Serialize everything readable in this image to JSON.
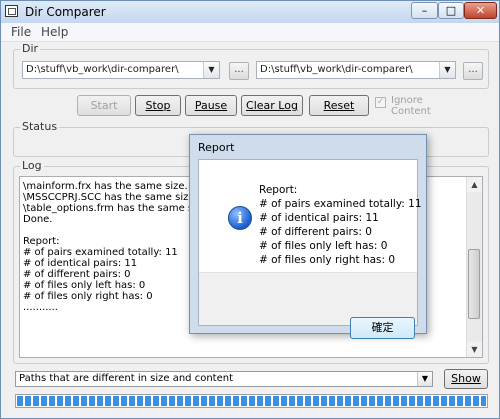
{
  "window": {
    "title": "Dir Comparer",
    "minimize": "–",
    "maximize": "□",
    "close": "✕"
  },
  "menu": {
    "items": [
      {
        "label": "File"
      },
      {
        "label": "Help"
      }
    ]
  },
  "dir_group": {
    "label": "Dir",
    "left_path": "D:\\stuff\\vb_work\\dir-comparer\\",
    "right_path": "D:\\stuff\\vb_work\\dir-comparer\\",
    "browse_label": "..."
  },
  "buttons": {
    "start": "Start",
    "stop": "Stop",
    "pause": "Pause",
    "clear_log": "Clear Log",
    "reset": "Reset"
  },
  "ignore_content": {
    "label": "Ignore Content",
    "checked": true
  },
  "status_group": {
    "label": "Status"
  },
  "log_group": {
    "label": "Log",
    "lines": [
      "\\mainform.frx has the same size.",
      "\\MSSCCPRJ.SCC has the same size.",
      "\\table_options.frm has the same size.",
      "Done.",
      "",
      "Report:",
      "# of pairs examined totally: 11",
      "# of identical pairs: 11",
      "# of different pairs: 0",
      "# of files only left has: 0",
      "# of files only right has: 0",
      "..........."
    ]
  },
  "filter": {
    "selected": "Paths that are different in size and content",
    "show_label": "Show"
  },
  "progress": {
    "fraction": 1.0
  },
  "dialog": {
    "title": "Report",
    "lines": [
      "Report:",
      "# of pairs examined totally: 11",
      "# of identical pairs: 11",
      "# of different pairs: 0",
      "# of files only left has: 0",
      "# of files only right has: 0"
    ],
    "ok_label": "確定",
    "icon": "info-icon"
  }
}
